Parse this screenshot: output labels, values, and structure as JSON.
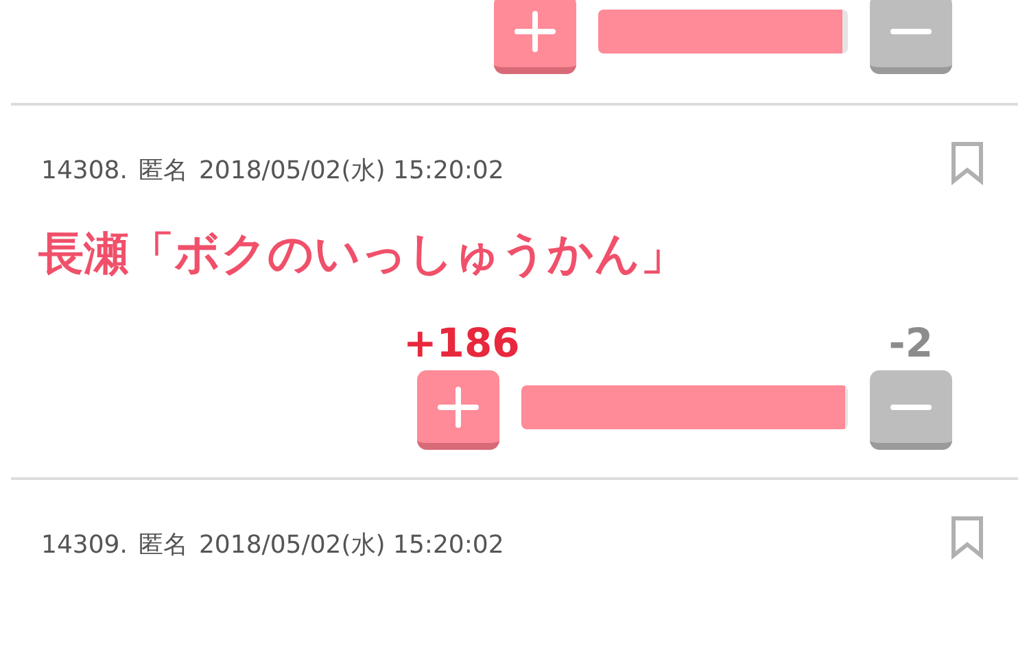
{
  "posts": [
    {
      "vote": {
        "level": 0.98
      }
    },
    {
      "number": "14308.",
      "author": "匿名",
      "date": "2018/05/02(水) 15:20:02",
      "bookmarked": false,
      "title": "長瀬「ボクのいっしゅうかん」",
      "vote": {
        "plus": "+186",
        "minus": "-2",
        "level": 0.99
      }
    },
    {
      "number": "14309.",
      "author": "匿名",
      "date": "2018/05/02(水) 15:20:02",
      "bookmarked": false
    }
  ]
}
